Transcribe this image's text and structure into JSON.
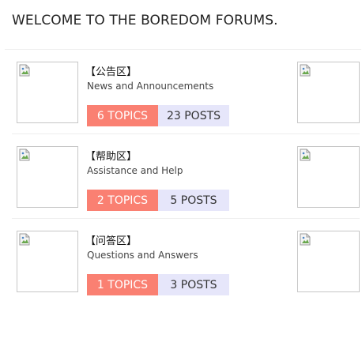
{
  "page": {
    "heading": "WELCOME TO THE BOREDOM FORUMS."
  },
  "forums": [
    {
      "title": "【公告区】",
      "description": "News and Announcements",
      "topics": "6 TOPICS",
      "posts": "23 POSTS"
    },
    {
      "title": "【帮助区】",
      "description": "Assistance and Help",
      "topics": "2 TOPICS",
      "posts": "5 POSTS"
    },
    {
      "title": "【问答区】",
      "description": "Questions and Answers",
      "topics": "1 TOPICS",
      "posts": "3 POSTS"
    }
  ],
  "icons": {
    "thumbnail": "broken-image-icon"
  },
  "colors": {
    "topics_badge": "#fa8072",
    "posts_badge": "#e6e6fa"
  }
}
